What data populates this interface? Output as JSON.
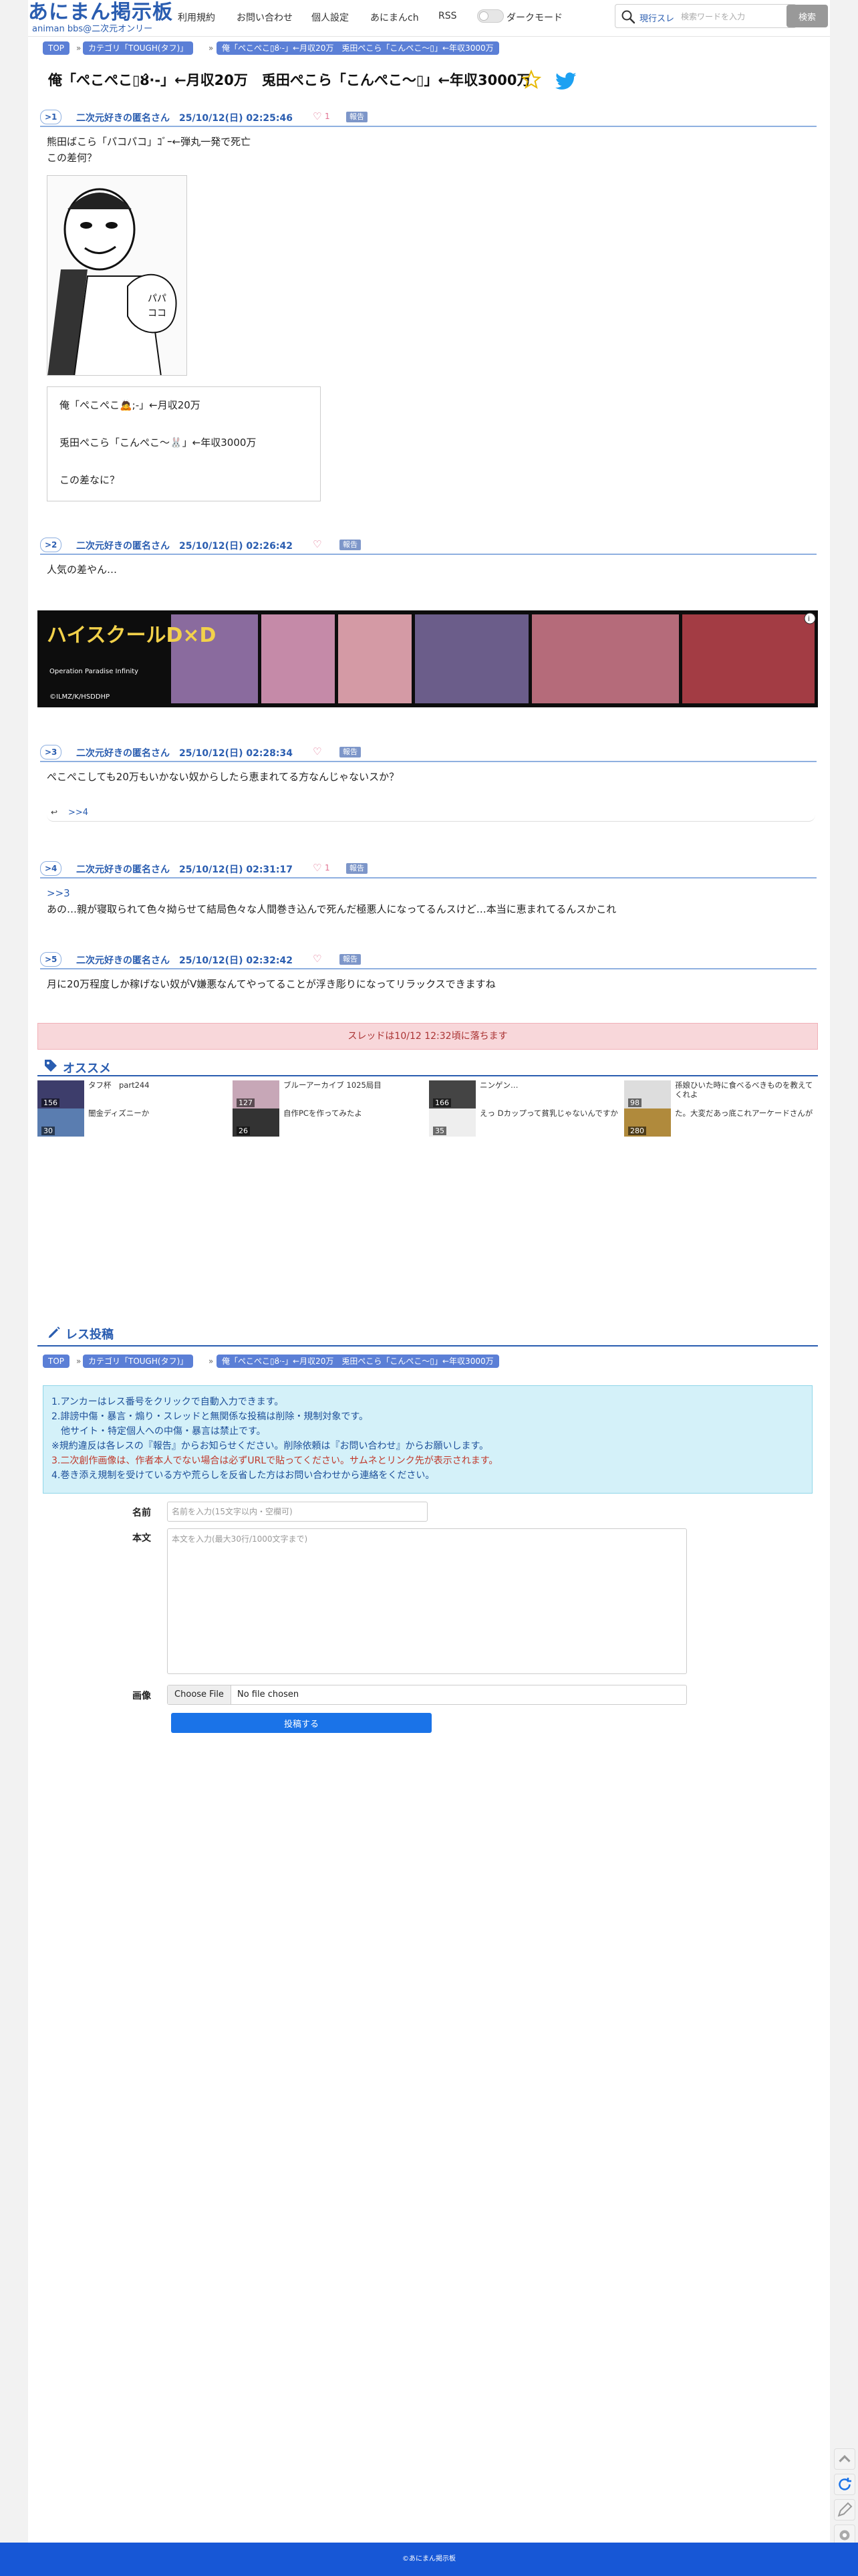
{
  "header": {
    "logo_main": "あにまん掲示板",
    "logo_sub": "animan bbs@二次元オンリー",
    "nav": [
      "利用規約",
      "お問い合わせ",
      "個人設定",
      "あにまんch",
      "RSS"
    ],
    "dark_mode_label": "ダークモード",
    "search_scope": "現行スレ",
    "search_placeholder": "検索ワードを入力",
    "search_button": "検索"
  },
  "breadcrumb": [
    "TOP",
    "カテゴリ「TOUGH(タフ)」",
    "俺「ぺこぺこ▯ȣ̂·-」←月収20万　兎田ぺこら「こんぺこ〜▯」←年収3000万"
  ],
  "thread_title": "俺「ぺこぺこ▯ȣ̂·-」←月収20万　兎田ぺこら「こんぺこ〜▯」←年収3000万",
  "posts": [
    {
      "num": ">1",
      "meta": "二次元好きの匿名さん　25/10/12(日) 02:25:46",
      "likes": "1",
      "report": "報告",
      "lines": [
        "熊田ばこら「パコパコ」ｺﾞｰ←弾丸一発で死亡",
        "この差何？"
      ],
      "image_text": "パパ ココ",
      "quote": [
        "俺「ぺこぺこ🙇;-」←月収20万",
        "兎田ぺこら「こんぺこ〜🐰」←年収3000万",
        "この差なに？"
      ]
    },
    {
      "num": ">2",
      "meta": "二次元好きの匿名さん　25/10/12(日) 02:26:42",
      "likes": "",
      "report": "報告",
      "lines": [
        "人気の差やん…"
      ]
    },
    {
      "num": ">3",
      "meta": "二次元好きの匿名さん　25/10/12(日) 02:28:34",
      "likes": "",
      "report": "報告",
      "lines": [
        "ぺこぺこしても20万もいかない奴からしたら恵まれてる方なんじゃないスか？"
      ],
      "reply": ">>4"
    },
    {
      "num": ">4",
      "meta": "二次元好きの匿名さん　25/10/12(日) 02:31:17",
      "likes": "1",
      "report": "報告",
      "anchor": ">>3",
      "lines": [
        "あの…親が寝取られて色々拗らせて結局色々な人間巻き込んで死んだ極悪人になってるんスけど…本当に恵まれてるんスかこれ"
      ]
    },
    {
      "num": ">5",
      "meta": "二次元好きの匿名さん　25/10/12(日) 02:32:42",
      "likes": "",
      "report": "報告",
      "lines": [
        "月に20万程度しか稼げない奴がV嫌悪なんてやってることが浮き彫りになってリラックスできますね"
      ]
    }
  ],
  "ad": {
    "title": "ハイスクールD×D",
    "subtitle": "Operation Paradise Infinity",
    "copyright": "©ILMZ/K/HSDDHP"
  },
  "expire_notice": "スレッドは10/12 12:32頃に落ちます",
  "recommend": {
    "title": "オススメ",
    "items": [
      {
        "title": "タフ杯　part244",
        "count": "156"
      },
      {
        "title": "ブルーアーカイブ 1025局目",
        "count": "127"
      },
      {
        "title": "ニンゲン…",
        "count": "166"
      },
      {
        "title": "孫娘ひいた時に食べるべきものを教えてくれよ",
        "count": "98"
      },
      {
        "title": "闇金ディズニーか",
        "count": "30"
      },
      {
        "title": "自作PCを作ってみたよ",
        "count": "26"
      },
      {
        "title": "えっ Dカップって貧乳じゃないんですか",
        "count": "35"
      },
      {
        "title": "た。大変だあっ底これアーケードさんが",
        "count": "280"
      }
    ]
  },
  "form": {
    "title": "レス投稿",
    "rules": [
      "1.アンカーはレス番号をクリックで自動入力できます。",
      "2.誹謗中傷・暴言・煽り・スレッドと無関係な投稿は削除・規制対象です。",
      "　他サイト・特定個人への中傷・暴言は禁止です。",
      "※規約違反は各レスの『報告』からお知らせください。削除依頼は『お問い合わせ』からお願いします。",
      "3.二次創作画像は、作者本人でない場合は必ずURLで貼ってください。サムネとリンク先が表示されます。",
      "4.巻き添え規制を受けている方や荒らしを反省した方はお問い合わせから連絡をください。"
    ],
    "name_label": "名前",
    "name_placeholder": "名前を入力(15文字以内・空欄可)",
    "body_label": "本文",
    "body_placeholder": "本文を入力(最大30行/1000文字まで)",
    "image_label": "画像",
    "file_button": "Choose File",
    "file_status": "No file chosen",
    "submit": "投稿する"
  },
  "footer": "©あにまん掲示板",
  "colors": {
    "accent": "#2a5db0",
    "crumb": "#5b7fd6",
    "footer": "#1757d6",
    "notice_bg": "#f8d7da",
    "rules_bg": "#d4f1f9"
  }
}
